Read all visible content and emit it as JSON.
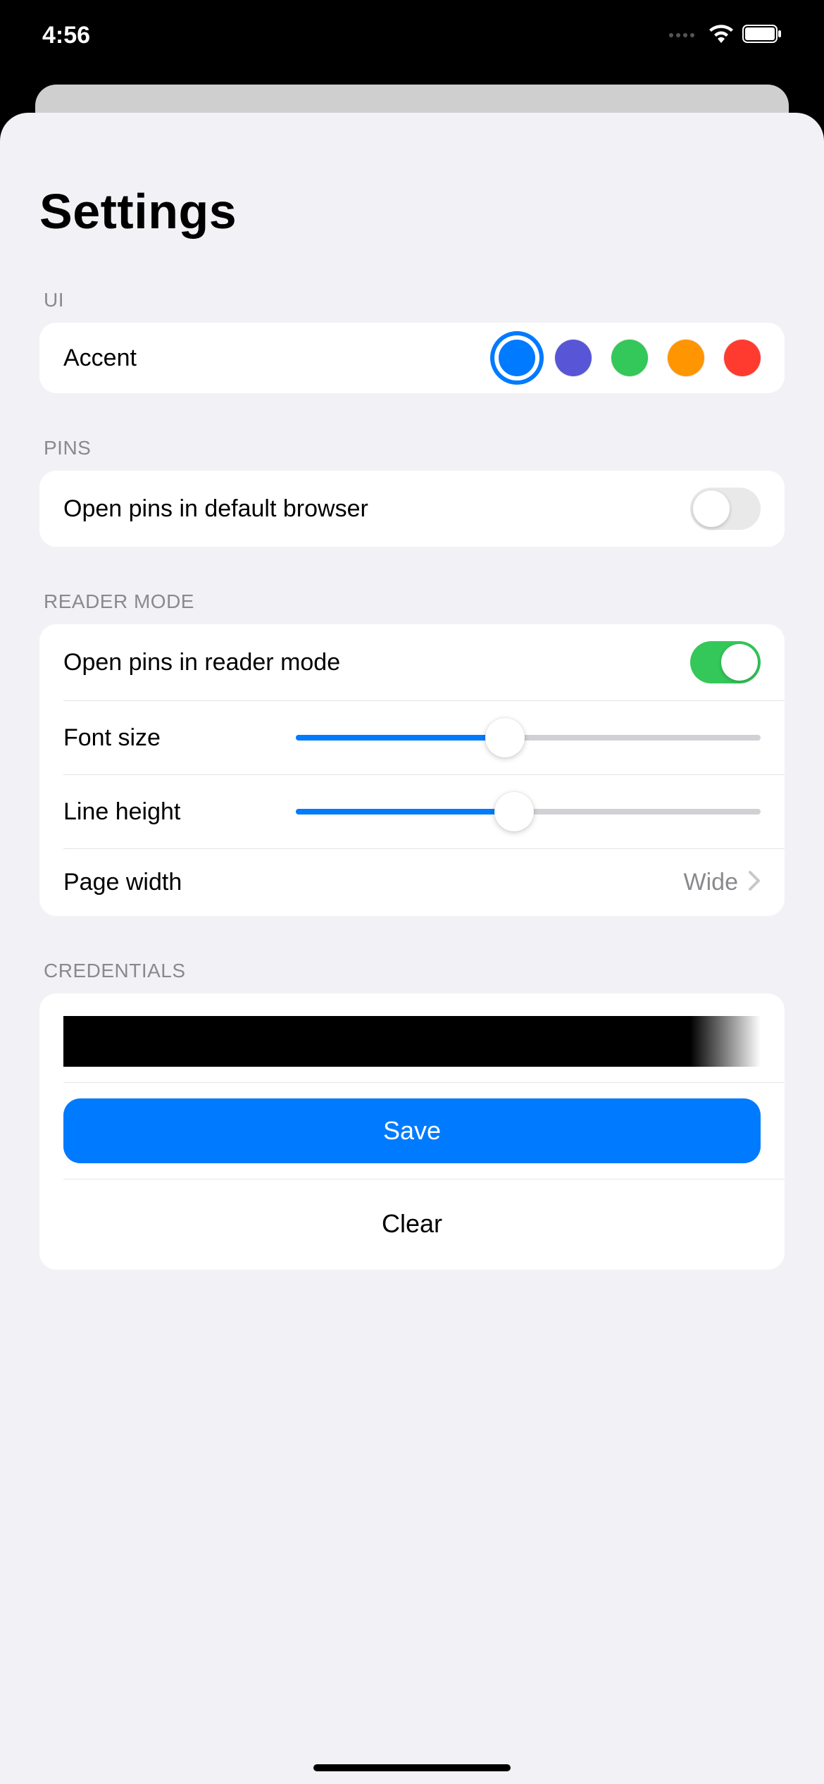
{
  "status": {
    "time": "4:56"
  },
  "page": {
    "title": "Settings"
  },
  "sections": {
    "ui": {
      "header": "UI",
      "accent": {
        "label": "Accent",
        "colors": [
          "#007aff",
          "#5856d6",
          "#34c759",
          "#ff9500",
          "#ff3b30"
        ],
        "selected_index": 0
      }
    },
    "pins": {
      "header": "PINS",
      "open_default": {
        "label": "Open pins in default browser",
        "value": false
      }
    },
    "reader": {
      "header": "READER MODE",
      "open_reader": {
        "label": "Open pins in reader mode",
        "value": true
      },
      "font_size": {
        "label": "Font size",
        "value": 45
      },
      "line_height": {
        "label": "Line height",
        "value": 47
      },
      "page_width": {
        "label": "Page width",
        "value": "Wide"
      }
    },
    "credentials": {
      "header": "CREDENTIALS",
      "save_label": "Save",
      "clear_label": "Clear"
    }
  }
}
